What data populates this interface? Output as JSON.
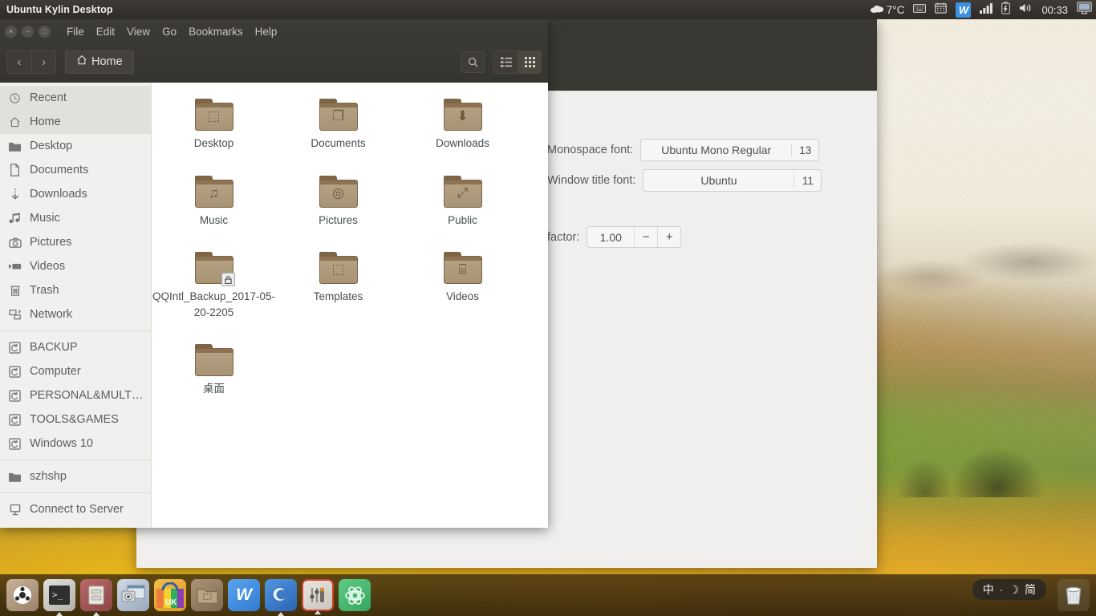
{
  "top_panel": {
    "title": "Ubuntu Kylin Desktop",
    "tray": {
      "weather_icon": "cloud-icon",
      "temperature": "7°C",
      "keyboard_icon": "keyboard-icon",
      "calendar_icon": "calendar-icon",
      "wps_icon": "wps-writer-icon",
      "wps_letter": "W",
      "signal_icon": "signal-bars-icon",
      "battery_icon": "battery-charging-icon",
      "volume_icon": "volume-icon",
      "clock": "00:33",
      "display_icon": "display-icon"
    }
  },
  "file_manager": {
    "window_controls": {
      "close": "×",
      "minimize": "−",
      "maximize": "□"
    },
    "menu": [
      "File",
      "Edit",
      "View",
      "Go",
      "Bookmarks",
      "Help"
    ],
    "nav": {
      "back": "‹",
      "forward": "›"
    },
    "location_button": {
      "icon": "home-icon",
      "label": "Home"
    },
    "toolbar": {
      "search_icon": "search-icon",
      "list_view_icon": "list-view-icon",
      "grid_view_icon": "grid-view-icon",
      "active_view": "grid"
    },
    "sidebar": {
      "groups": [
        {
          "items": [
            {
              "label": "Recent",
              "icon": "clock-icon",
              "active": false
            },
            {
              "label": "Home",
              "icon": "home-icon",
              "active": true
            },
            {
              "label": "Desktop",
              "icon": "folder-icon",
              "active": false
            },
            {
              "label": "Documents",
              "icon": "document-icon",
              "active": false
            },
            {
              "label": "Downloads",
              "icon": "download-icon",
              "active": false
            },
            {
              "label": "Music",
              "icon": "music-icon",
              "active": false
            },
            {
              "label": "Pictures",
              "icon": "camera-icon",
              "active": false
            },
            {
              "label": "Videos",
              "icon": "video-icon",
              "active": false
            },
            {
              "label": "Trash",
              "icon": "trash-icon",
              "active": false
            },
            {
              "label": "Network",
              "icon": "network-icon",
              "active": false
            }
          ]
        },
        {
          "items": [
            {
              "label": "BACKUP",
              "icon": "drive-icon",
              "active": false
            },
            {
              "label": "Computer",
              "icon": "drive-icon",
              "active": false
            },
            {
              "label": "PERSONAL&MULT…",
              "icon": "drive-icon",
              "active": false
            },
            {
              "label": "TOOLS&GAMES",
              "icon": "drive-icon",
              "active": false
            },
            {
              "label": "Windows 10",
              "icon": "drive-icon",
              "active": false
            }
          ]
        },
        {
          "items": [
            {
              "label": "szhshp",
              "icon": "folder-icon",
              "active": false
            }
          ]
        },
        {
          "items": [
            {
              "label": "Connect to Server",
              "icon": "server-icon",
              "active": false
            }
          ]
        }
      ]
    },
    "files": [
      {
        "name": "Desktop",
        "icon": "folder-desktop-icon",
        "glyph": "⬚",
        "locked": false
      },
      {
        "name": "Documents",
        "icon": "folder-documents-icon",
        "glyph": "❐",
        "locked": false
      },
      {
        "name": "Downloads",
        "icon": "folder-downloads-icon",
        "glyph": "⬇",
        "locked": false
      },
      {
        "name": "Music",
        "icon": "folder-music-icon",
        "glyph": "♫",
        "locked": false
      },
      {
        "name": "Pictures",
        "icon": "folder-pictures-icon",
        "glyph": "◎",
        "locked": false
      },
      {
        "name": "Public",
        "icon": "folder-public-icon",
        "glyph": "⤢",
        "locked": false
      },
      {
        "name": "QQIntl_Backup_2017-05-20-2205",
        "icon": "folder-locked-icon",
        "glyph": "",
        "locked": true
      },
      {
        "name": "Templates",
        "icon": "folder-templates-icon",
        "glyph": "⬚",
        "locked": false
      },
      {
        "name": "Videos",
        "icon": "folder-videos-icon",
        "glyph": "⌸",
        "locked": false
      },
      {
        "name": "桌面",
        "icon": "folder-icon",
        "glyph": "",
        "locked": false
      }
    ]
  },
  "settings_window": {
    "monospace_font": {
      "label": "Monospace font:",
      "value": "Ubuntu Mono Regular",
      "size": "13"
    },
    "window_title_font": {
      "label": "Window title font:",
      "value": "Ubuntu",
      "size": "11"
    },
    "scaling": {
      "label": "factor:",
      "value": "1.00",
      "minus": "−",
      "plus": "+"
    }
  },
  "taskbar": {
    "launchers": [
      {
        "name": "ubuntu-start-icon",
        "glyph": "ⓞ",
        "bg": "#b09a86",
        "running": false
      },
      {
        "name": "terminal-icon",
        "glyph": "⌫",
        "bg": "#c9c6c0",
        "running": true
      },
      {
        "name": "file-manager-icon",
        "glyph": "⌸",
        "bg": "#a35b5b",
        "running": true
      },
      {
        "name": "screenshot-icon",
        "glyph": "❐",
        "bg": "#a9b6c6",
        "running": false
      },
      {
        "name": "ubuntu-kylin-software-center-icon",
        "glyph": "UK",
        "bg": "#e8b23a",
        "running": false
      },
      {
        "name": "desktop-folder-icon",
        "glyph": "⬚",
        "bg": "#9b8a70",
        "running": false
      },
      {
        "name": "wps-writer-icon",
        "glyph": "W",
        "bg": "#3d8fe0",
        "running": false
      },
      {
        "name": "browser-icon",
        "glyph": "◔",
        "bg": "#3f7fd0",
        "running": true
      },
      {
        "name": "sound-mixer-icon",
        "glyph": "‖",
        "bg": "#d84b3a",
        "running": true
      },
      {
        "name": "kylin-assistant-icon",
        "glyph": "⚛",
        "bg": "#44b06a",
        "running": false
      }
    ],
    "ime": {
      "lang": "中",
      "dot": "·",
      "moon": "☽",
      "mode": "简"
    },
    "trash": {
      "name": "trash-icon",
      "glyph": "🗑"
    }
  }
}
